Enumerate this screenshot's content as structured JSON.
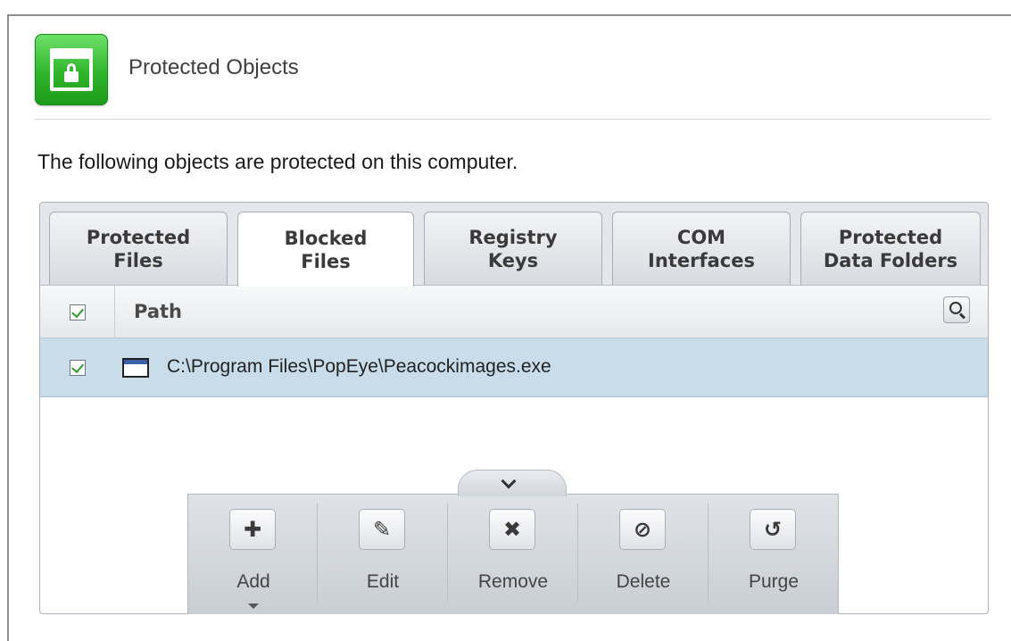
{
  "header": {
    "title": "Protected Objects"
  },
  "description": "The following objects are protected on this computer.",
  "tabs": [
    {
      "label": "Protected\nFiles",
      "active": false
    },
    {
      "label": "Blocked\nFiles",
      "active": true
    },
    {
      "label": "Registry\nKeys",
      "active": false
    },
    {
      "label": "COM\nInterfaces",
      "active": false
    },
    {
      "label": "Protected\nData Folders",
      "active": false
    }
  ],
  "table": {
    "columns": [
      "Path"
    ],
    "rows": [
      {
        "path": "C:\\Program Files\\PopEye\\Peacockimages.exe",
        "checked": true,
        "selected": true
      }
    ]
  },
  "toolbar": {
    "buttons": [
      {
        "label": "Add",
        "icon": "plus-icon"
      },
      {
        "label": "Edit",
        "icon": "pencil-icon"
      },
      {
        "label": "Remove",
        "icon": "x-icon"
      },
      {
        "label": "Delete",
        "icon": "block-icon"
      },
      {
        "label": "Purge",
        "icon": "refresh-icon"
      }
    ]
  },
  "colors": {
    "accent_green": "#2fb52b",
    "selected_row": "#c8dde9"
  }
}
